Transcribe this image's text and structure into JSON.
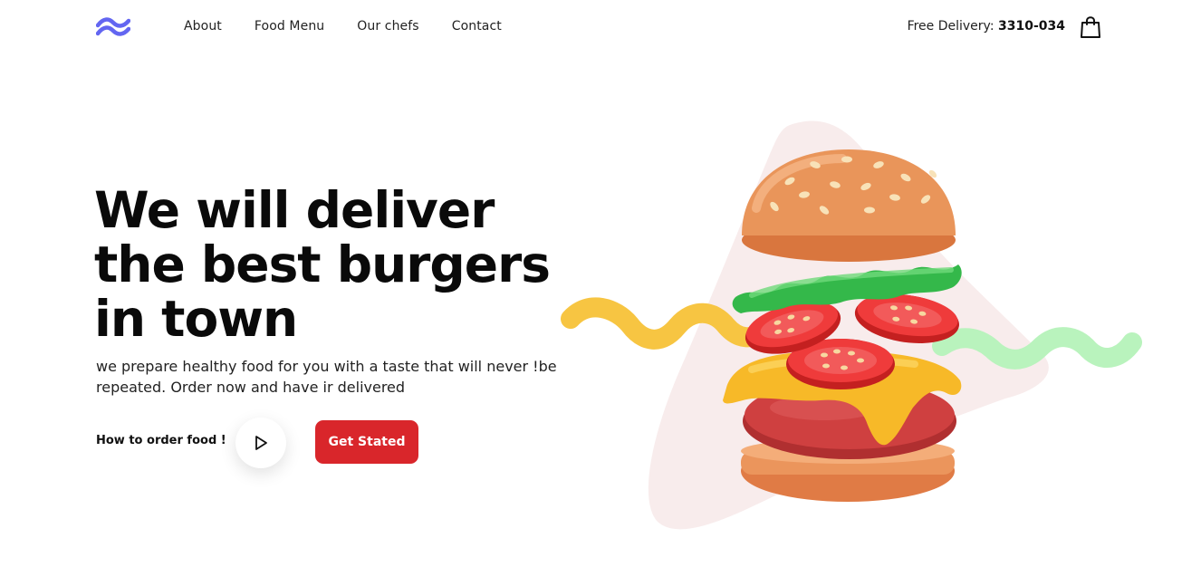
{
  "nav": {
    "logo_icon": "wave-logo-icon",
    "links": [
      "About",
      "Food Menu",
      "Our chefs",
      "Contact"
    ]
  },
  "header": {
    "delivery_label": "Free Delivery:",
    "delivery_number": "3310-034",
    "cart_icon": "shopping-bag-icon"
  },
  "hero": {
    "title_lines": [
      "We will deliver",
      "the best burgers",
      "in town"
    ],
    "subtitle_lines": [
      "we prepare healthy food for you with a taste that will never !be",
      "repeated. Order now and have ir delivered"
    ],
    "how_to_order": "How to order food !",
    "play_icon": "play-icon",
    "cta_label": "Get Stated"
  },
  "illustration": {
    "name": "burger-illustration",
    "colors": {
      "blob": "#f8ecec",
      "yellow_squiggle": "#f7c542",
      "green_squiggle": "#b9f3bd",
      "bun": "#e9955a",
      "lettuce": "#34b84a",
      "tomato": "#e8312f",
      "cheese": "#f7b928",
      "patty": "#c93a3a"
    }
  },
  "theme": {
    "accent": "#d9262b",
    "logo": "#6366f1"
  }
}
